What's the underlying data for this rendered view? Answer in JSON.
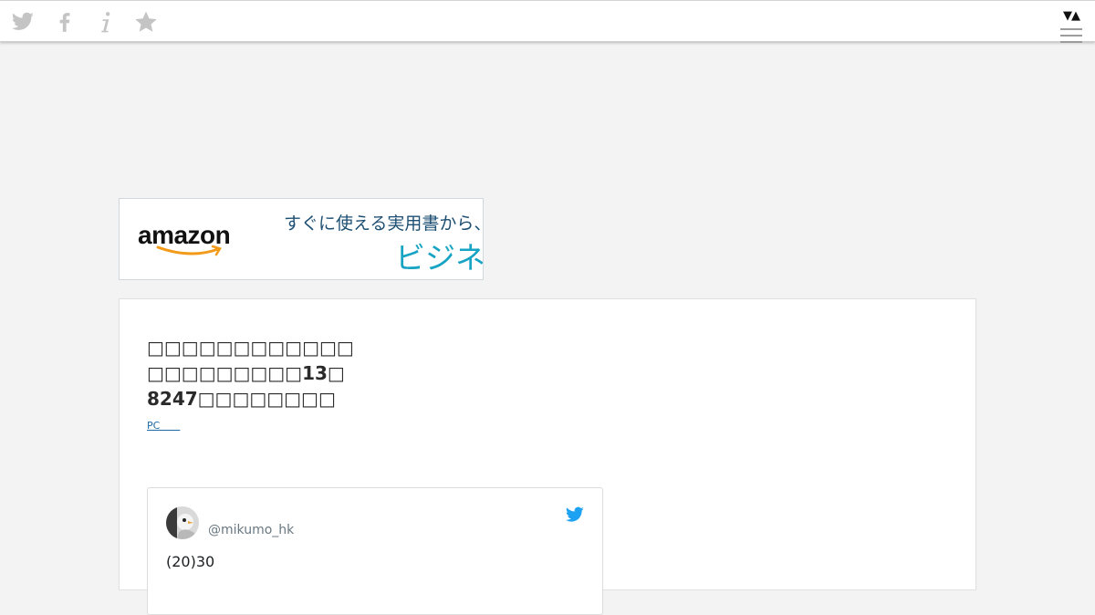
{
  "topbar": {
    "icons": [
      "twitter-icon",
      "facebook-icon",
      "info-icon",
      "star-icon"
    ],
    "sort_toggle": "▼▲",
    "icon_color": "#c4c4c4"
  },
  "ad": {
    "logo": "amazon",
    "line1": "すぐに使える実用書から、話",
    "line2": "ビジネス",
    "colors": {
      "line1": "#1d4f73",
      "line2": "#17a4c4",
      "smile": "#f29a1a"
    }
  },
  "article": {
    "title_lines": [
      "□□□□□□□□□□□□",
      "□□□□□□□□□13□",
      "8247□□□□□□□□"
    ],
    "pc_link": "PC　　"
  },
  "tweet": {
    "handle": "@mikumo_hk",
    "text": "(20)30",
    "bird_color": "#1da1f2"
  }
}
